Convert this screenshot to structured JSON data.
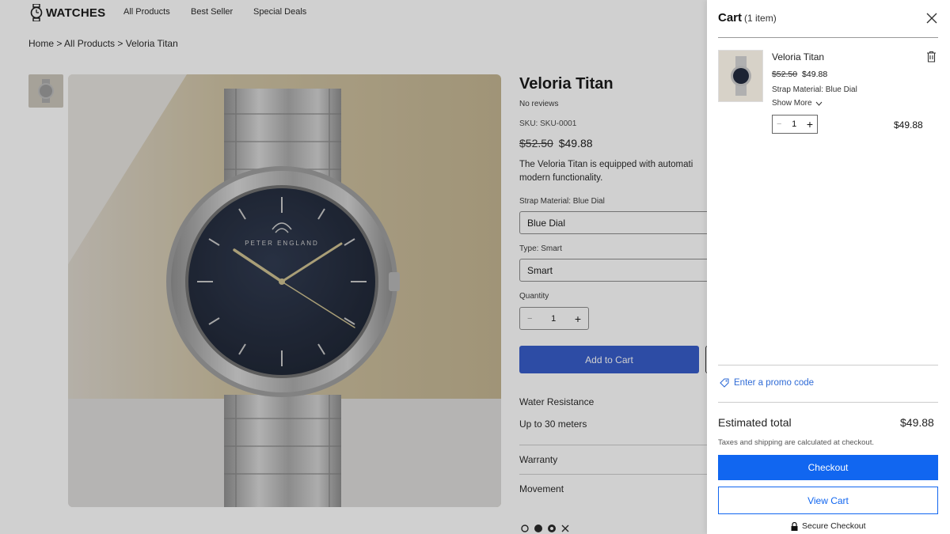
{
  "header": {
    "logo_text": "WATCHES",
    "nav": [
      "All Products",
      "Best Seller",
      "Special Deals"
    ]
  },
  "breadcrumb": "Home > All Products > Veloria Titan",
  "product": {
    "title": "Veloria Titan",
    "reviews": "No reviews",
    "sku": "SKU: SKU-0001",
    "old_price": "$52.50",
    "price": "$49.88",
    "description_line1": "The Veloria Titan is equipped with automati",
    "description_line2": "modern functionality.",
    "strap_label": "Strap Material: Blue Dial",
    "strap_value": "Blue Dial",
    "type_label": "Type: Smart",
    "type_value": "Smart",
    "quantity_label": "Quantity",
    "quantity": "1",
    "add_to_cart": "Add to Cart",
    "water_resistance_label": "Water Resistance",
    "water_resistance_value": "Up to 30 meters",
    "warranty_label": "Warranty",
    "movement_label": "Movement",
    "dial_brand": "PETER ENGLAND"
  },
  "cart": {
    "title": "Cart",
    "count": "(1 item)",
    "item": {
      "name": "Veloria Titan",
      "old_price": "$52.50",
      "price": "$49.88",
      "strap": "Strap Material: Blue Dial",
      "show_more": "Show More",
      "quantity": "1",
      "line_total": "$49.88"
    },
    "promo": "Enter a promo code",
    "estimated_label": "Estimated total",
    "estimated_value": "$49.88",
    "tax_note": "Taxes and shipping are calculated at checkout.",
    "checkout": "Checkout",
    "view_cart": "View Cart",
    "secure": "Secure Checkout"
  },
  "colors": {
    "add_to_cart_bg": "#2f57c8",
    "checkout_bg": "#1166f0",
    "promo_link": "#2f6bd6"
  }
}
